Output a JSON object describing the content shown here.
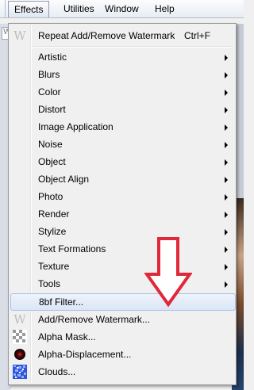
{
  "menubar": {
    "items": [
      {
        "label": "Effects",
        "active": true
      },
      {
        "label": "Utilities"
      },
      {
        "label": "Window"
      },
      {
        "label": "Help"
      }
    ]
  },
  "menu": {
    "repeat": {
      "label": "Repeat Add/Remove Watermark",
      "shortcut": "Ctrl+F",
      "icon": "watermark-w-icon"
    },
    "submenus": [
      "Artistic",
      "Blurs",
      "Color",
      "Distort",
      "Image Application",
      "Noise",
      "Object",
      "Object Align",
      "Photo",
      "Render",
      "Stylize",
      "Text Formations",
      "Texture",
      "Tools"
    ],
    "plugins": [
      {
        "label": "8bf Filter...",
        "highlighted": true
      },
      {
        "label": "Add/Remove Watermark...",
        "icon": "watermark-w-icon"
      },
      {
        "label": "Alpha Mask...",
        "icon": "checker-mask-icon"
      },
      {
        "label": "Alpha-Displacement...",
        "icon": "displacement-sphere-icon"
      },
      {
        "label": "Clouds...",
        "icon": "clouds-pattern-icon"
      }
    ]
  },
  "toolbar": {
    "w_label": "W"
  },
  "colors": {
    "highlight": "#dbe6f6",
    "arrow": "#e0283a",
    "menu_bg": "#f0f0f0"
  }
}
